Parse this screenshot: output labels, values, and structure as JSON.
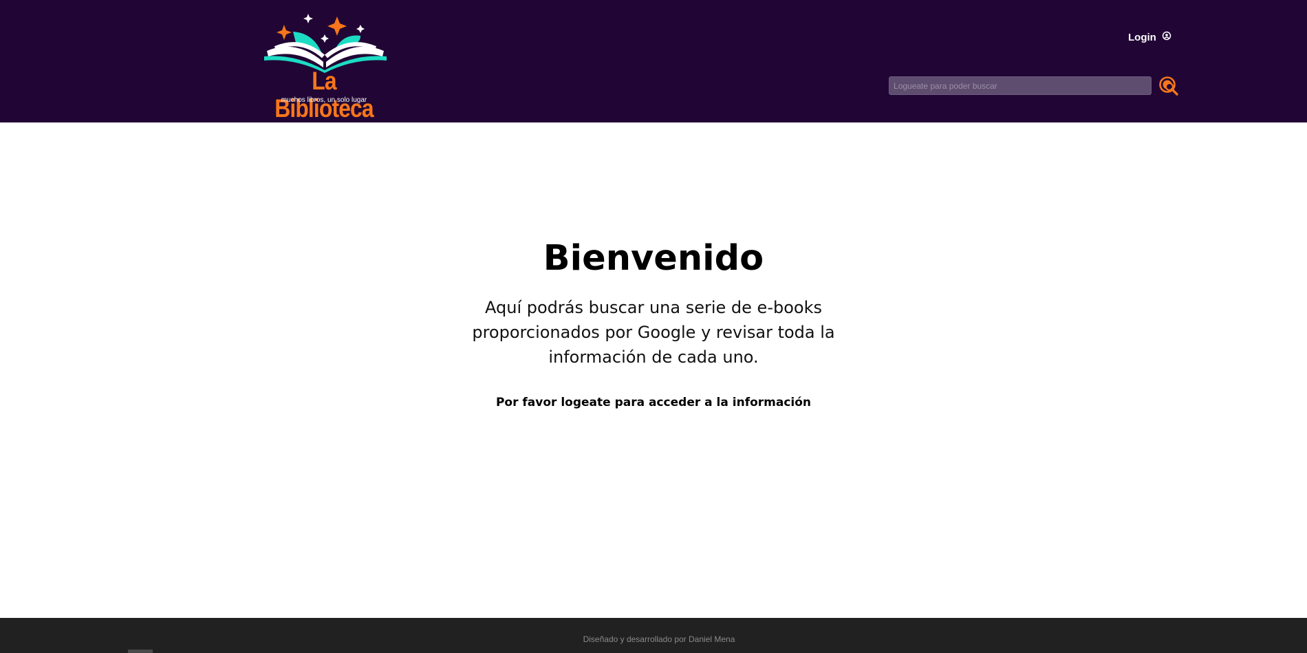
{
  "brand": {
    "name": "La Biblioteca",
    "tagline": "muchos libros, un solo lugar",
    "colors": {
      "primary": "#f6761b",
      "accent": "#1ddcc4",
      "header_bg": "#210635"
    }
  },
  "header": {
    "login_label": "Login",
    "login_icon": "user-circle-icon",
    "search": {
      "placeholder": "Logueate para poder buscar",
      "value": "",
      "button_icon": "search-icon"
    }
  },
  "main": {
    "title": "Bienvenido",
    "description": "Aquí podrás buscar una serie de e-books proporcionados por Google y revisar toda la información de cada uno.",
    "notice": "Por favor logeate para acceder a la información"
  },
  "footer": {
    "credit": "Diseñado y desarrollado por Daniel Mena"
  }
}
